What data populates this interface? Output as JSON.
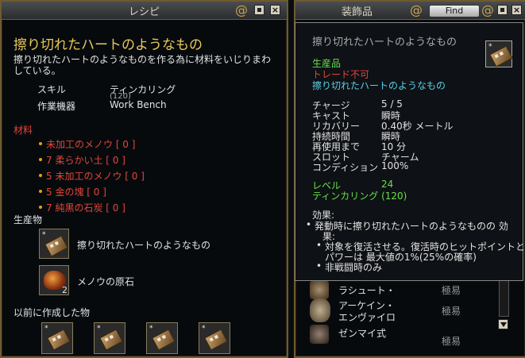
{
  "recipe_window": {
    "title": "レシピ",
    "item_title": "擦り切れたハートのようなもの",
    "description": "擦り切れたハートのようなものを作る為に材料をいじりまわしている。",
    "desc_line1": "擦り切れたハートのようなものを作る為に材料をいじりまわ",
    "desc_line2": "している。",
    "skill_label": "スキル",
    "skill_value": "ティンカリング",
    "skill_level": "(120)",
    "station_label": "作業機器",
    "station_value": "Work Bench",
    "materials_header": "材料",
    "materials": [
      {
        "text": "未加工のメノウ [ 0 ]"
      },
      {
        "text": "7 柔らかい土 [ 0 ]"
      },
      {
        "text": "5 未加工のメノウ [ 0 ]"
      },
      {
        "text": "5 金の塊 [ 0 ]"
      },
      {
        "text": "7 純黒の石炭 [ 0 ]"
      }
    ],
    "products_header": "生産物",
    "products": [
      {
        "name": "擦り切れたハートのようなもの",
        "icon": "worn-heart-icon",
        "count": ""
      },
      {
        "name": "メノウの原石",
        "icon": "agate-ore-icon",
        "count": "2"
      }
    ],
    "previously_made_header": "以前に作成した物",
    "previously_made": [
      {
        "icon": "worn-heart-icon"
      },
      {
        "icon": "worn-heart-icon"
      },
      {
        "icon": "worn-heart-icon"
      },
      {
        "icon": "worn-heart-icon"
      }
    ]
  },
  "accessory_window": {
    "title": "装飾品",
    "find_label": "Find",
    "list_items": [
      {
        "name": "ラシュート・",
        "difficulty": "極易"
      },
      {
        "name": "アーケイン・",
        "name2": "エンヴァイロ",
        "difficulty": "極易"
      },
      {
        "name": "ゼンマイ式",
        "difficulty": "極易"
      }
    ]
  },
  "tooltip": {
    "title": "擦り切れたハートのようなもの",
    "tag_crafted": "生産品",
    "tag_no_trade": "トレード不可",
    "tag_name": "擦り切れたハートのようなもの",
    "stats": [
      {
        "label": "チャージ",
        "value": "5 / 5"
      },
      {
        "label": "キャスト",
        "value": "瞬時"
      },
      {
        "label": "リカバリー",
        "value": "0.40秒 メートル"
      },
      {
        "label": "持続時間",
        "value": "瞬時"
      },
      {
        "label": "再使用まで",
        "value": "10 分"
      },
      {
        "label": "スロット",
        "value": "チャーム"
      },
      {
        "label": "コンディション",
        "value": "100%"
      }
    ],
    "level_label": "レベル",
    "level_value": "24",
    "skill_req": "ティンカリング (120)",
    "effects_header": "効果:",
    "effect_line1": "発動時に擦り切れたハートのようなものの 効",
    "effect_line1b": "果:",
    "effect_sub1": "対象を復活させる。復活時のヒットポイントと",
    "effect_sub1b": "パワーは 最大値の1%(25%の確率)",
    "effect_sub2": "非戦闘時のみ"
  },
  "colors": {
    "title_gold": "#e8c95a",
    "material_red": "#e0463a",
    "crafted_green": "#66e04a",
    "link_cyan": "#5ad0e8",
    "border_gold": "#6f5a30"
  }
}
